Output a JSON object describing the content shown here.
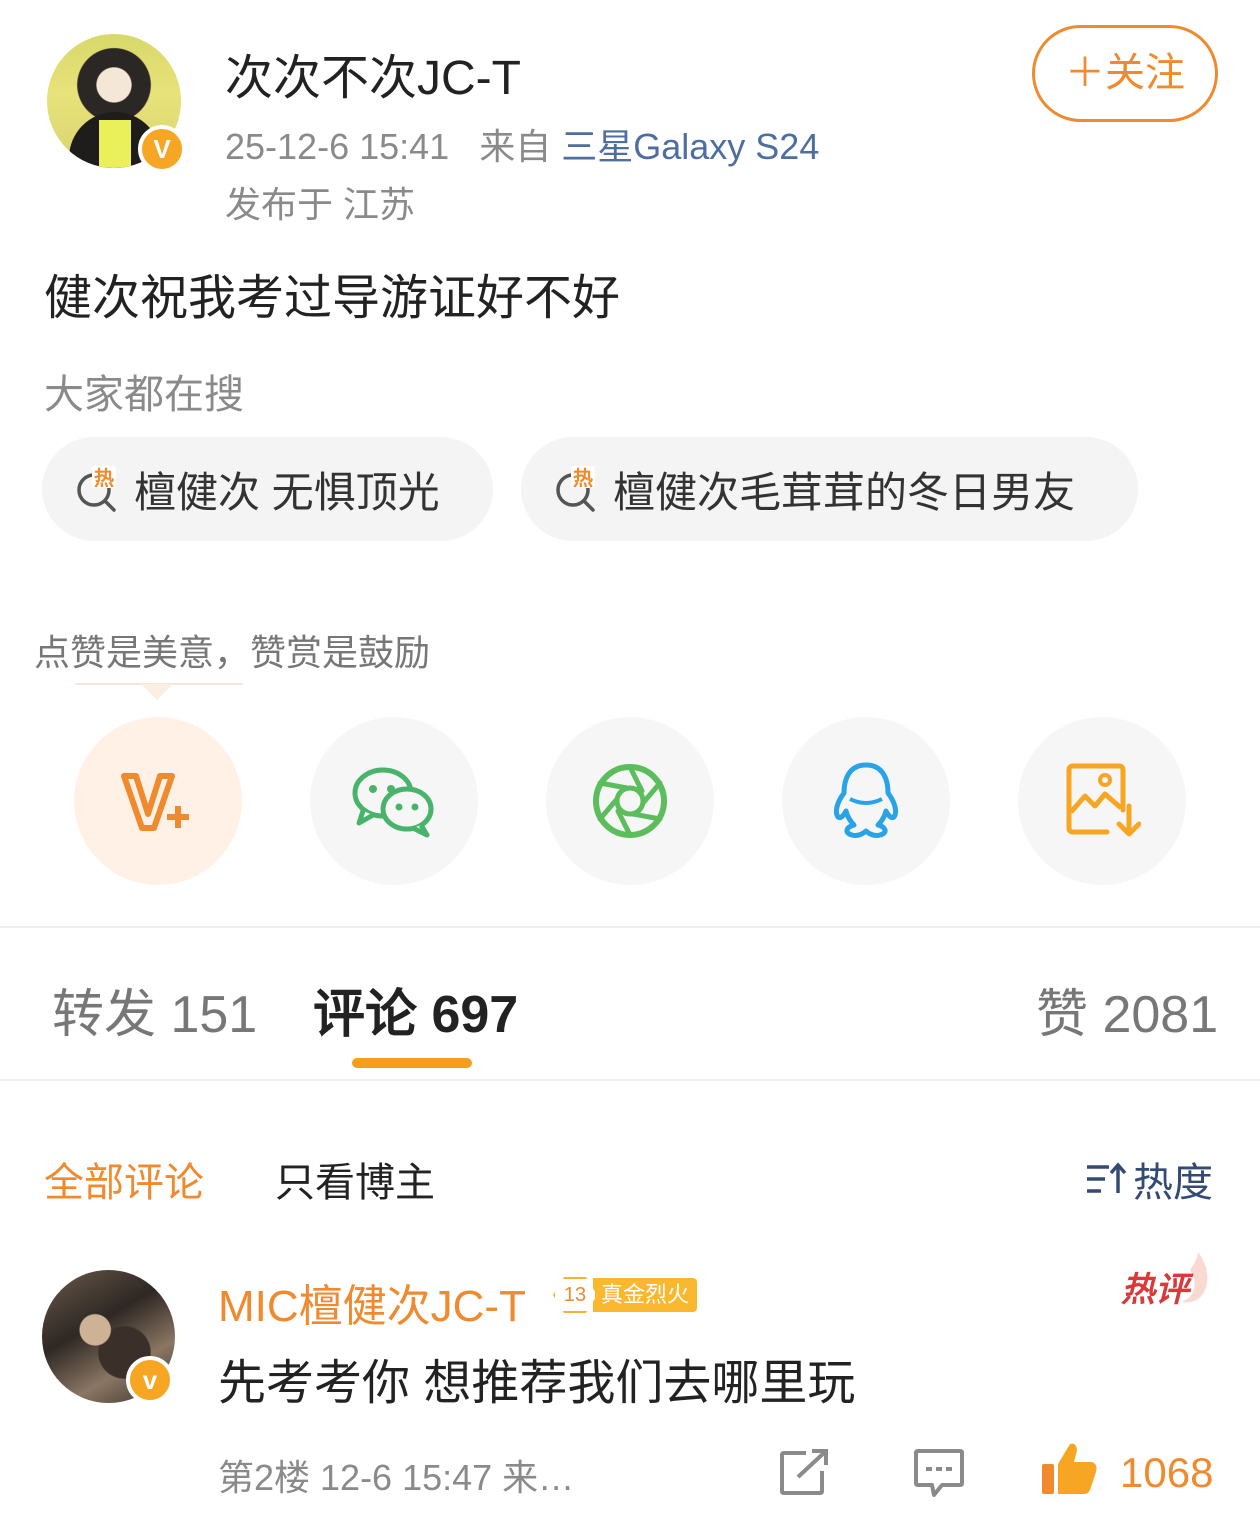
{
  "post": {
    "username": "次次不次JC-T",
    "time": "25-12-6 15:41",
    "source_prefix": "来自",
    "device": "三星Galaxy S24",
    "location": "发布于 江苏",
    "verified_badge": "V",
    "follow_label": "＋关注",
    "text": "健次祝我考过导游证好不好"
  },
  "search": {
    "hint": "大家都在搜",
    "chips": [
      {
        "label": "檀健次 无惧顶光",
        "icon": "hot-search-icon"
      },
      {
        "label": "檀健次毛茸茸的冬日男友",
        "icon": "hot-search-icon"
      }
    ]
  },
  "reward": {
    "hint": "点赞是美意，赞赏是鼓励"
  },
  "share": {
    "buttons": [
      {
        "icon": "reward-v-plus-icon",
        "color": "#f08a2e"
      },
      {
        "icon": "wechat-icon",
        "color": "#48b36a"
      },
      {
        "icon": "moments-icon",
        "color": "#5bbd5b"
      },
      {
        "icon": "qq-icon",
        "color": "#2aa3e6"
      },
      {
        "icon": "save-image-icon",
        "color": "#f6a623"
      }
    ]
  },
  "tabs": {
    "repost": "转发 151",
    "comment": "评论 697",
    "like": "赞 2081"
  },
  "filters": {
    "all": "全部评论",
    "author_only": "只看博主",
    "sort": "热度"
  },
  "comment": {
    "user": "MIC檀健次JC-T",
    "fan_level": "13",
    "fan_title": "真金烈火",
    "verified_badge": "v",
    "hot_label": "热评",
    "text": "先考考你 想推荐我们去哪里玩",
    "meta": "第2楼 12-6 15:47 来…",
    "likes": "1068"
  },
  "colors": {
    "accent": "#f08a2e",
    "tab_underline": "#f79d1e",
    "link_blue": "#4e6ea1"
  }
}
